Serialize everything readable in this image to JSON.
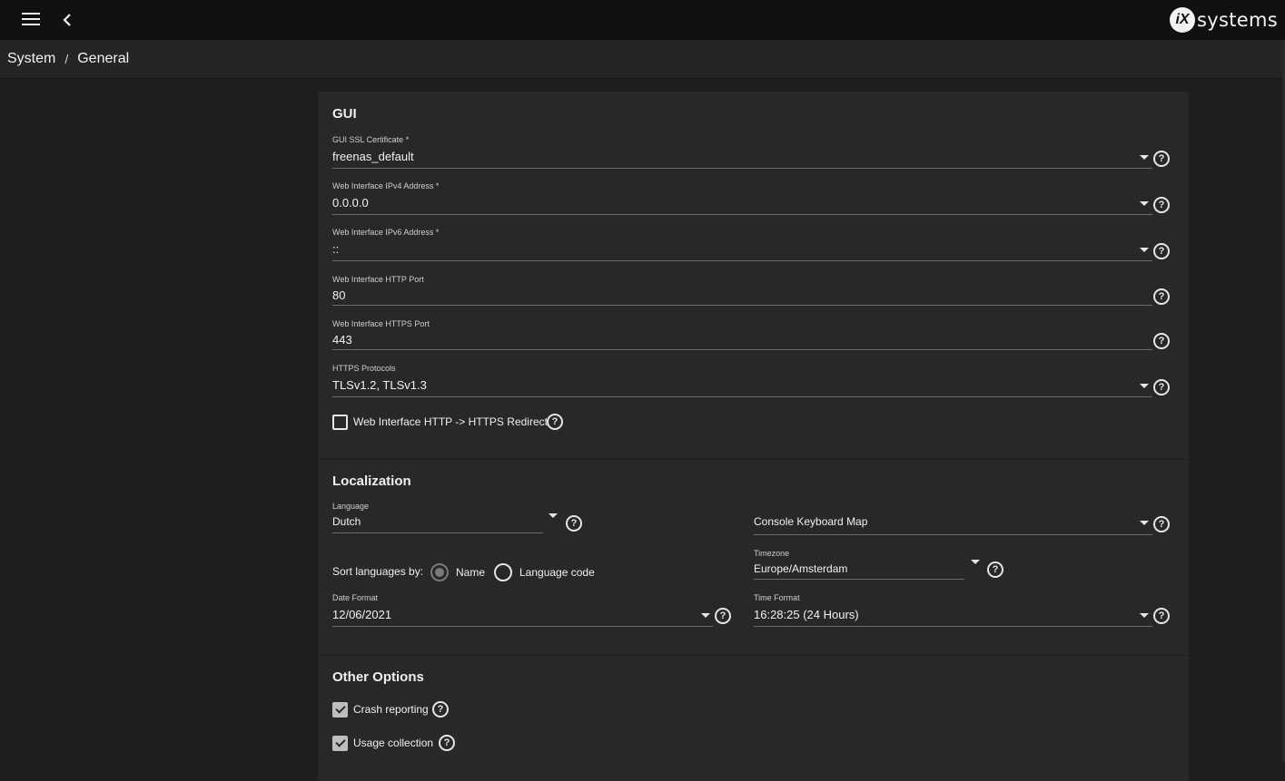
{
  "topbar": {
    "logo_mark": "iX",
    "logo_text": "systems"
  },
  "breadcrumb": {
    "items": [
      "System",
      "General"
    ],
    "separator": "/"
  },
  "gui": {
    "title": "GUI",
    "ssl_cert": {
      "label": "GUI SSL Certificate *",
      "value": "freenas_default"
    },
    "ipv4": {
      "label": "Web Interface IPv4 Address *",
      "value": "0.0.0.0"
    },
    "ipv6": {
      "label": "Web Interface IPv6 Address *",
      "value": "::"
    },
    "http_port": {
      "label": "Web Interface HTTP Port",
      "value": "80"
    },
    "https_port": {
      "label": "Web Interface HTTPS Port",
      "value": "443"
    },
    "https_protocols": {
      "label": "HTTPS Protocols",
      "value": "TLSv1.2, TLSv1.3"
    },
    "redirect": {
      "label": "Web Interface HTTP -> HTTPS Redirect",
      "checked": false
    }
  },
  "localization": {
    "title": "Localization",
    "language": {
      "label": "Language",
      "value": "Dutch"
    },
    "console_keymap": {
      "label": "Console Keyboard Map",
      "value": ""
    },
    "sort_label": "Sort languages by:",
    "sort_options": [
      "Name",
      "Language code"
    ],
    "sort_selected": "Name",
    "timezone": {
      "label": "Timezone",
      "value": "Europe/Amsterdam"
    },
    "date_format": {
      "label": "Date Format",
      "value": "12/06/2021"
    },
    "time_format": {
      "label": "Time Format",
      "value": "16:28:25 (24 Hours)"
    }
  },
  "other": {
    "title": "Other Options",
    "crash_reporting": {
      "label": "Crash reporting",
      "checked": true
    },
    "usage_collection": {
      "label": "Usage collection",
      "checked": true
    }
  },
  "help_glyph": "?"
}
